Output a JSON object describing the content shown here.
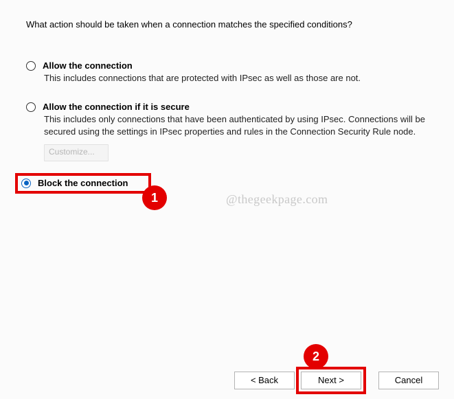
{
  "prompt": "What action should be taken when a connection matches the specified conditions?",
  "options": {
    "allow": {
      "title": "Allow the connection",
      "desc": "This includes connections that are protected with IPsec as well as those are not."
    },
    "allow_secure": {
      "title": "Allow the connection if it is secure",
      "desc": "This includes only connections that have been authenticated by using IPsec.  Connections will be secured using the settings in IPsec properties and rules in the Connection Security Rule node.",
      "customize_label": "Customize..."
    },
    "block": {
      "title": "Block the connection"
    }
  },
  "watermark": "@thegeekpage.com",
  "annotations": {
    "badge1": "1",
    "badge2": "2"
  },
  "footer": {
    "back": "< Back",
    "next": "Next >",
    "cancel": "Cancel"
  }
}
